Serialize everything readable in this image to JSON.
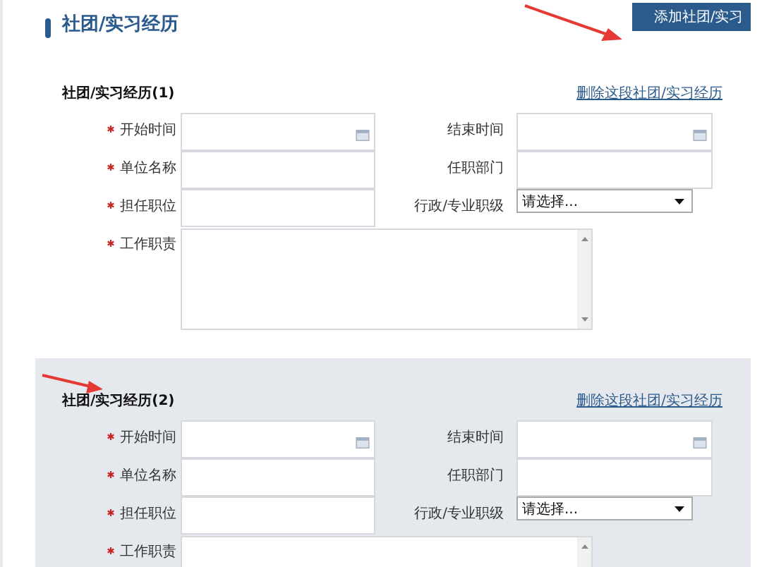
{
  "title": "社团/实习经历",
  "add_button": "添加社团/实习",
  "sections": [
    {
      "title": "社团/实习经历(1)",
      "delete_link": "删除这段社团/实习经历",
      "highlighted": false,
      "fields": [
        {
          "kind": "date",
          "label": "开始时间",
          "required": true
        },
        {
          "kind": "date",
          "label": "结束时间",
          "required": false
        },
        {
          "kind": "text",
          "label": "单位名称",
          "required": true
        },
        {
          "kind": "text",
          "label": "任职部门",
          "required": false
        },
        {
          "kind": "text",
          "label": "担任职位",
          "required": true
        },
        {
          "kind": "select",
          "label": "行政/专业职级",
          "required": false,
          "value": "请选择..."
        },
        {
          "kind": "textarea",
          "label": "工作职责",
          "required": true
        }
      ]
    },
    {
      "title": "社团/实习经历(2)",
      "delete_link": "删除这段社团/实习经历",
      "highlighted": true,
      "fields": [
        {
          "kind": "date",
          "label": "开始时间",
          "required": true
        },
        {
          "kind": "date",
          "label": "结束时间",
          "required": false
        },
        {
          "kind": "text",
          "label": "单位名称",
          "required": true
        },
        {
          "kind": "text",
          "label": "任职部门",
          "required": false
        },
        {
          "kind": "text",
          "label": "担任职位",
          "required": true
        },
        {
          "kind": "select",
          "label": "行政/专业职级",
          "required": false,
          "value": "请选择..."
        },
        {
          "kind": "textarea",
          "label": "工作职责",
          "required": true
        }
      ]
    }
  ]
}
